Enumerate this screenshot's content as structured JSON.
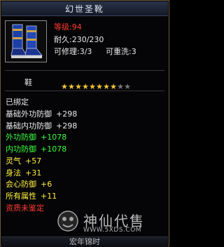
{
  "title": "幻世圣靴",
  "item": {
    "level": "等级:94",
    "durability": "耐久:230/230",
    "repairable": "可修理:3/3",
    "rewash": "可重洗:3",
    "slot": "鞋",
    "stars_total": 10,
    "stars_filled": 8
  },
  "bound_status": "已绑定",
  "stats": [
    {
      "label": "基础外功防御",
      "value": "+298",
      "color": "white"
    },
    {
      "label": "基础内功防御",
      "value": "+298",
      "color": "white"
    },
    {
      "label": "外功防御",
      "value": "+1078",
      "color": "green"
    },
    {
      "label": "内功防御",
      "value": "+1078",
      "color": "green"
    },
    {
      "label": "灵气",
      "value": "+57",
      "color": "yellow"
    },
    {
      "label": "身法",
      "value": "+31",
      "color": "yellow"
    },
    {
      "label": "会心防御",
      "value": "+6",
      "color": "yellow"
    },
    {
      "label": "所有属性",
      "value": "+11",
      "color": "yellow"
    }
  ],
  "quality_note": "资质未鉴定",
  "watermark": {
    "brand": "神仙代售",
    "url": "WWW.5XDS.COM"
  },
  "footer_text": "宏年锦时"
}
